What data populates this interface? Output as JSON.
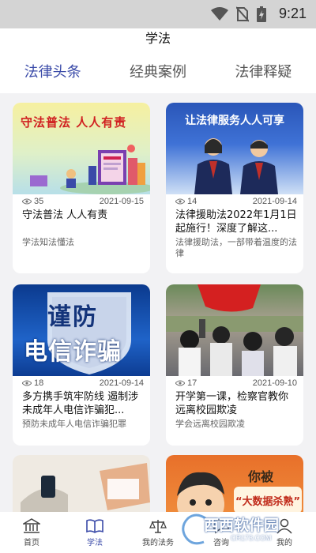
{
  "status": {
    "time": "9:21"
  },
  "header": {
    "title": "学法"
  },
  "tabs": [
    {
      "label": "法律头条",
      "active": true
    },
    {
      "label": "经典案例",
      "active": false
    },
    {
      "label": "法律释疑",
      "active": false
    }
  ],
  "cards": [
    {
      "image_caption": "守法普法 人人有责",
      "views": "35",
      "date": "2021-09-15",
      "title": "守法普法 人人有责",
      "subtitle": "学法知法懂法"
    },
    {
      "image_caption": "让法律服务人人可享",
      "views": "14",
      "date": "2021-09-14",
      "title": "法律援助法2022年1月1日起施行！深度了解这...",
      "subtitle": "法律援助法，一部带着温度的法律"
    },
    {
      "image_caption_line1": "谨防",
      "image_caption_line2": "电信诈骗",
      "views": "18",
      "date": "2021-09-14",
      "title": "多方携手筑牢防线 遏制涉未成年人电信诈骗犯...",
      "subtitle": "预防未成年人电信诈骗犯罪"
    },
    {
      "views": "17",
      "date": "2021-09-10",
      "title": "开学第一课，检察官教你远离校园欺凌",
      "subtitle": "学会远离校园欺凌"
    },
    {
      "partial": true
    },
    {
      "image_caption_line1": "你被",
      "image_caption_line2": "“大数据杀熟”",
      "partial": true
    }
  ],
  "bottom_nav": [
    {
      "label": "首页",
      "icon": "bank-icon",
      "active": false
    },
    {
      "label": "学法",
      "icon": "book-icon",
      "active": true
    },
    {
      "label": "我的法务",
      "icon": "scale-icon",
      "active": false
    },
    {
      "label": "咨询",
      "icon": "chat-icon",
      "active": false
    },
    {
      "label": "我的",
      "icon": "user-icon",
      "active": false
    }
  ],
  "watermark": {
    "text": "西西软件园",
    "sub": "CR173.COM"
  },
  "colors": {
    "accent": "#3a4aa8",
    "tab_inactive": "#555555",
    "background": "#f2f2f4",
    "statusbar": "#d4d4d4"
  }
}
